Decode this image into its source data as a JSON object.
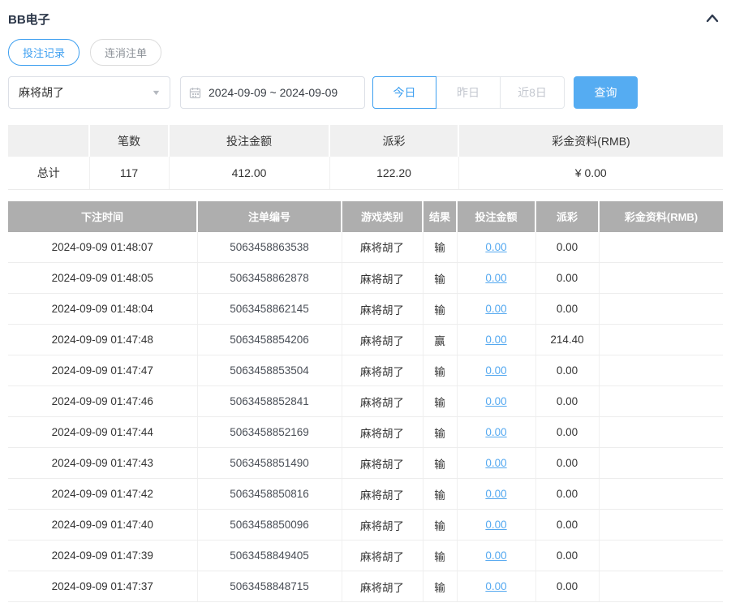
{
  "header": {
    "title": "BB电子"
  },
  "tabs": [
    {
      "label": "投注记录",
      "active": true
    },
    {
      "label": "连消注单",
      "active": false
    }
  ],
  "toolbar": {
    "game_select_value": "麻将胡了",
    "date_range": "2024-09-09 ~ 2024-09-09",
    "quick_ranges": [
      {
        "label": "今日",
        "active": true
      },
      {
        "label": "昨日",
        "active": false
      },
      {
        "label": "近8日",
        "active": false
      }
    ],
    "search_label": "查询"
  },
  "summary_table": {
    "columns": [
      "",
      "笔数",
      "投注金额",
      "派彩",
      "彩金资料(RMB)"
    ],
    "row": [
      "总计",
      "117",
      "412.00",
      "122.20",
      "¥ 0.00"
    ]
  },
  "records_table": {
    "columns": [
      "下注时间",
      "注单编号",
      "游戏类别",
      "结果",
      "投注金额",
      "派彩",
      "彩金资料(RMB)"
    ],
    "rows": [
      {
        "time": "2024-09-09 01:48:07",
        "order_id": "5063458863538",
        "game": "麻将胡了",
        "result": "输",
        "bet_amount": "0.00",
        "payout": "0.00",
        "jackpot": ""
      },
      {
        "time": "2024-09-09 01:48:05",
        "order_id": "5063458862878",
        "game": "麻将胡了",
        "result": "输",
        "bet_amount": "0.00",
        "payout": "0.00",
        "jackpot": ""
      },
      {
        "time": "2024-09-09 01:48:04",
        "order_id": "5063458862145",
        "game": "麻将胡了",
        "result": "输",
        "bet_amount": "0.00",
        "payout": "0.00",
        "jackpot": ""
      },
      {
        "time": "2024-09-09 01:47:48",
        "order_id": "5063458854206",
        "game": "麻将胡了",
        "result": "赢",
        "bet_amount": "0.00",
        "payout": "214.40",
        "jackpot": ""
      },
      {
        "time": "2024-09-09 01:47:47",
        "order_id": "5063458853504",
        "game": "麻将胡了",
        "result": "输",
        "bet_amount": "0.00",
        "payout": "0.00",
        "jackpot": ""
      },
      {
        "time": "2024-09-09 01:47:46",
        "order_id": "5063458852841",
        "game": "麻将胡了",
        "result": "输",
        "bet_amount": "0.00",
        "payout": "0.00",
        "jackpot": ""
      },
      {
        "time": "2024-09-09 01:47:44",
        "order_id": "5063458852169",
        "game": "麻将胡了",
        "result": "输",
        "bet_amount": "0.00",
        "payout": "0.00",
        "jackpot": ""
      },
      {
        "time": "2024-09-09 01:47:43",
        "order_id": "5063458851490",
        "game": "麻将胡了",
        "result": "输",
        "bet_amount": "0.00",
        "payout": "0.00",
        "jackpot": ""
      },
      {
        "time": "2024-09-09 01:47:42",
        "order_id": "5063458850816",
        "game": "麻将胡了",
        "result": "输",
        "bet_amount": "0.00",
        "payout": "0.00",
        "jackpot": ""
      },
      {
        "time": "2024-09-09 01:47:40",
        "order_id": "5063458850096",
        "game": "麻将胡了",
        "result": "输",
        "bet_amount": "0.00",
        "payout": "0.00",
        "jackpot": ""
      },
      {
        "time": "2024-09-09 01:47:39",
        "order_id": "5063458849405",
        "game": "麻将胡了",
        "result": "输",
        "bet_amount": "0.00",
        "payout": "0.00",
        "jackpot": ""
      },
      {
        "time": "2024-09-09 01:47:37",
        "order_id": "5063458848715",
        "game": "麻将胡了",
        "result": "输",
        "bet_amount": "0.00",
        "payout": "0.00",
        "jackpot": ""
      }
    ]
  },
  "colors": {
    "accent_blue": "#3d9ff0",
    "button_blue": "#55acf2",
    "link_blue": "#55a9f0",
    "records_header_bg": "#aeaeae",
    "summary_header_bg": "#f0f0f0",
    "title_color": "#2b3648"
  }
}
